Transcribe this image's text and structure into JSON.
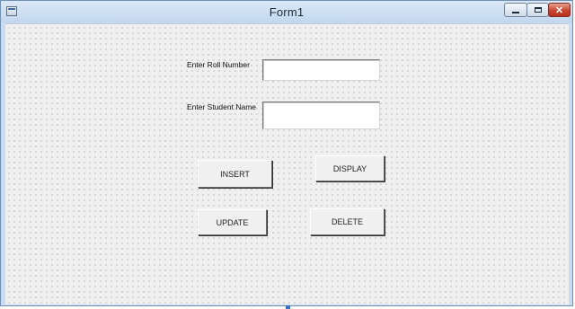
{
  "window": {
    "title": "Form1",
    "controls": {
      "minimize_icon": "minimize-icon",
      "maximize_icon": "maximize-icon",
      "close_icon": "close-icon"
    }
  },
  "form": {
    "roll_label": "Enter Roll Number",
    "roll_value": "",
    "name_label": "Enter Student Name",
    "name_value": "",
    "buttons": {
      "insert": "INSERT",
      "display": "DISPLAY",
      "update": "UPDATE",
      "delete": "DELETE"
    }
  }
}
